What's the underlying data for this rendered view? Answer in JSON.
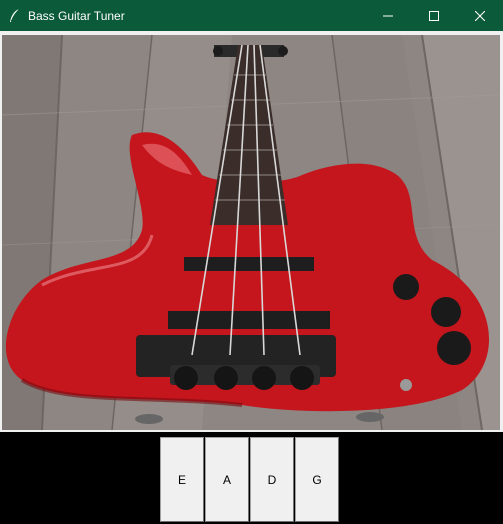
{
  "window": {
    "title": "Bass Guitar Tuner",
    "titlebar_color": "#0b5a3a"
  },
  "icons": {
    "app": "feather-icon",
    "minimize": "minimize-icon",
    "maximize": "maximize-icon",
    "close": "close-icon"
  },
  "strings": [
    {
      "label": "E"
    },
    {
      "label": "A"
    },
    {
      "label": "D"
    },
    {
      "label": "G"
    }
  ],
  "colors": {
    "guitar_body": "#c4161c",
    "floor": "#8b8480",
    "hardware": "#2a2a2a"
  }
}
